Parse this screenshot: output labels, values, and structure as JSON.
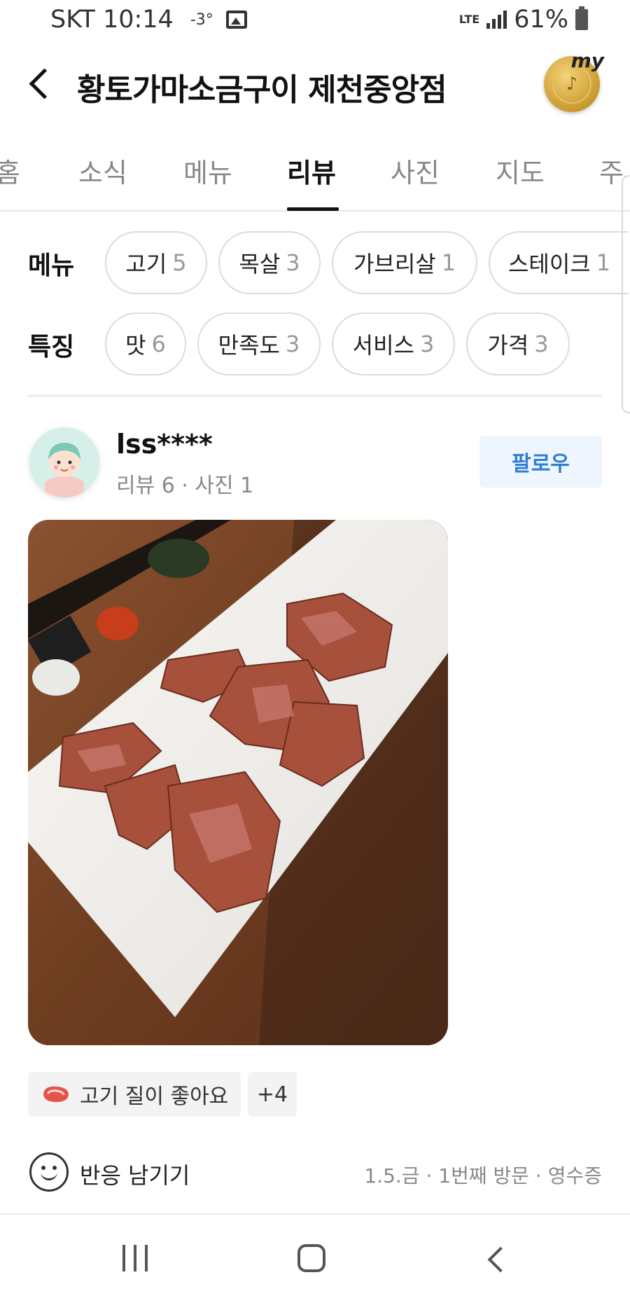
{
  "status_bar": {
    "carrier_time": "SKT 10:14",
    "temperature": "-3°",
    "network": "LTE",
    "battery": "61%"
  },
  "header": {
    "title": "황토가마소금구이 제천중앙점",
    "badge_label": "my"
  },
  "tabs": [
    {
      "label": "홈"
    },
    {
      "label": "소식"
    },
    {
      "label": "메뉴"
    },
    {
      "label": "리뷰",
      "active": true
    },
    {
      "label": "사진"
    },
    {
      "label": "지도"
    },
    {
      "label": "주"
    }
  ],
  "filters": {
    "menu": {
      "label": "메뉴",
      "chips": [
        {
          "text": "고기",
          "count": "5"
        },
        {
          "text": "목살",
          "count": "3"
        },
        {
          "text": "가브리살",
          "count": "1"
        },
        {
          "text": "스테이크",
          "count": "1"
        }
      ]
    },
    "feature": {
      "label": "특징",
      "chips": [
        {
          "text": "맛",
          "count": "6"
        },
        {
          "text": "만족도",
          "count": "3"
        },
        {
          "text": "서비스",
          "count": "3"
        },
        {
          "text": "가격",
          "count": "3"
        }
      ]
    }
  },
  "review": {
    "username": "lss****",
    "meta": "리뷰 6 · 사진 1",
    "follow_label": "팔로우",
    "tags": [
      {
        "icon": "meat-icon",
        "text": "고기 질이 좋아요"
      },
      {
        "text": "+4"
      }
    ],
    "reaction_label": "반응 남기기",
    "visit_meta": "1.5.금 · 1번째 방문 · 영수증"
  },
  "colors": {
    "accent_blue": "#2f7fd6",
    "follow_bg": "#eef5fc"
  }
}
